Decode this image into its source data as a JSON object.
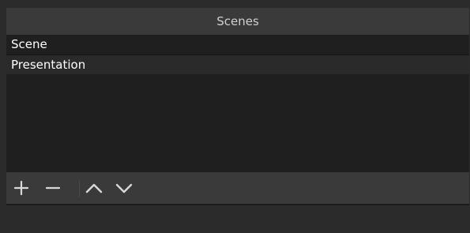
{
  "dock": {
    "title": "Scenes"
  },
  "scenes": {
    "items": [
      {
        "label": "Scene"
      },
      {
        "label": "Presentation"
      }
    ]
  },
  "toolbar": {
    "buttons": [
      {
        "icon": "plus-icon"
      },
      {
        "icon": "minus-icon"
      },
      {
        "icon": "chevron-up-icon"
      },
      {
        "icon": "chevron-down-icon"
      }
    ]
  },
  "colors": {
    "title_bar": "#3a3a3a",
    "list_background": "#1f1f1f",
    "selected_row": "#2a2a2a",
    "text": "#ffffff",
    "icon": "#d8d8d8"
  }
}
